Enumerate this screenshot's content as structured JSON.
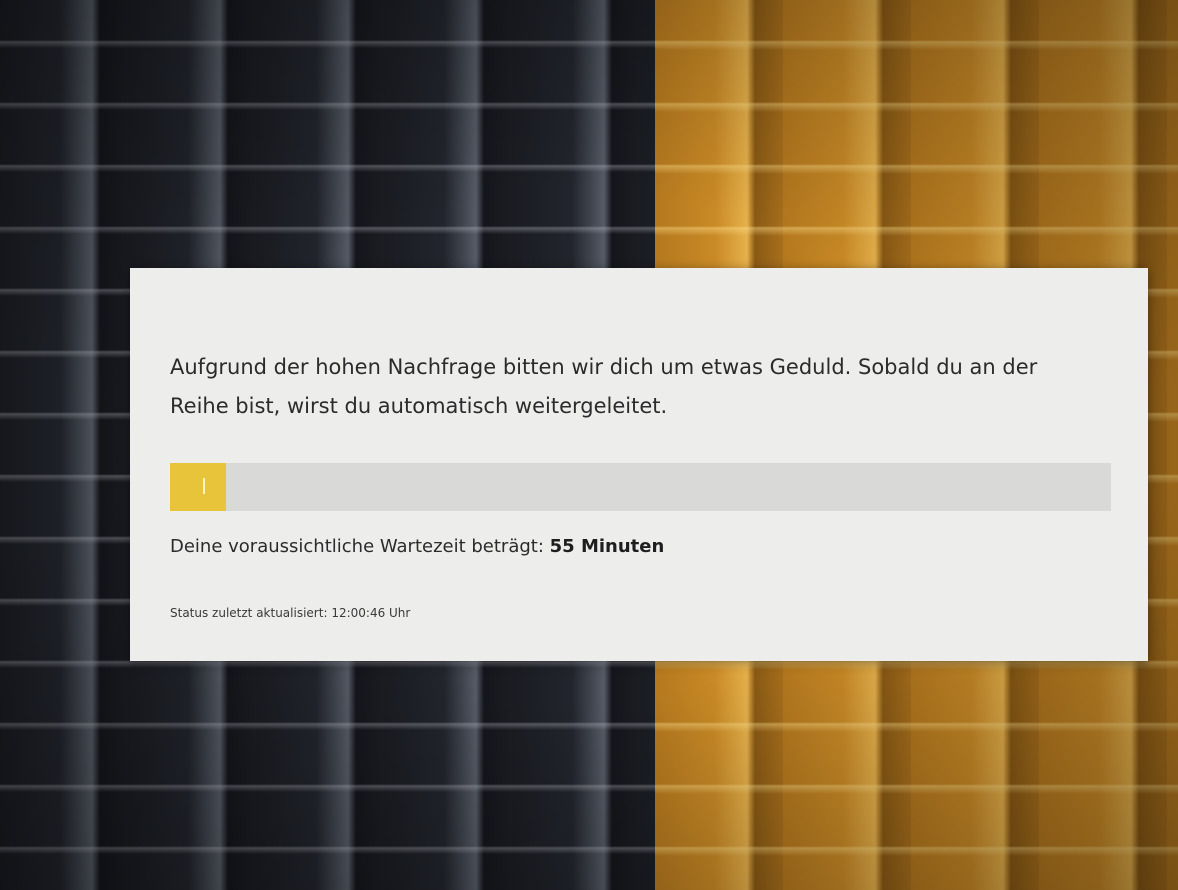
{
  "waiting_room": {
    "message": "Aufgrund der hohen Nachfrage bitten wir dich um etwas Geduld. Sobald du an der Reihe bist, wirst du automatisch weitergeleitet.",
    "progress_percent": 6,
    "progress_color": "#e8c43a",
    "wait_label": "Deine voraussichtliche Wartezeit beträgt:",
    "wait_value": "55 Minuten",
    "status_label": "Status zuletzt aktualisiert:",
    "status_time": "12:00:46 Uhr"
  }
}
